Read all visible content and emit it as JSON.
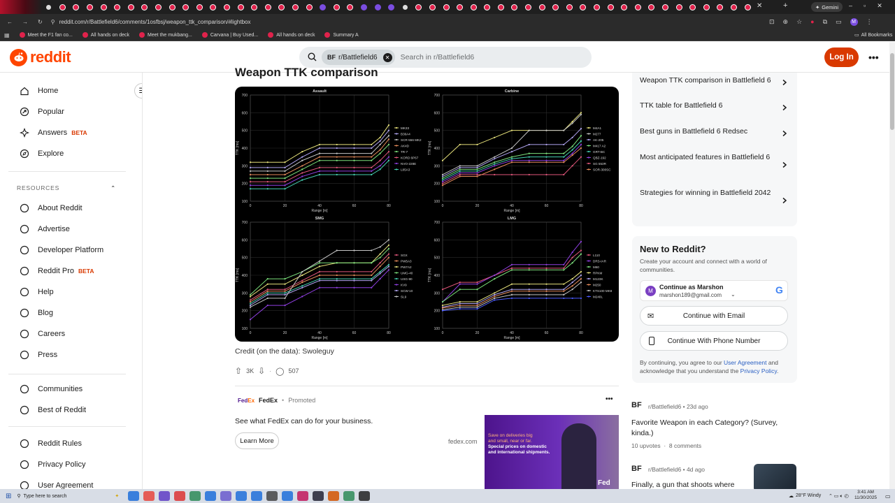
{
  "browser": {
    "url": "reddit.com/r/Battlefield6/comments/1osfbsj/weapon_ttk_comparison/#lightbox",
    "gemini_label": "Gemini",
    "bookmarks": [
      "Meet the F1 fan co...",
      "All hands on deck",
      "Meet the mukbang...",
      "Carvana | Buy Used...",
      "All hands on deck",
      "Summary A"
    ],
    "all_bookmarks": "All Bookmarks"
  },
  "header": {
    "logo_text": "reddit",
    "search_chip": "r/Battlefield6",
    "search_placeholder": "Search in r/Battlefield6",
    "login_label": "Log In"
  },
  "leftnav": {
    "main_items": [
      {
        "label": "Home",
        "icon": "home-icon"
      },
      {
        "label": "Popular",
        "icon": "popular-icon"
      },
      {
        "label": "Answers",
        "badge": "BETA",
        "icon": "answers-icon"
      },
      {
        "label": "Explore",
        "icon": "explore-icon"
      }
    ],
    "resources_header": "RESOURCES",
    "resources": [
      {
        "label": "About Reddit"
      },
      {
        "label": "Advertise"
      },
      {
        "label": "Developer Platform"
      },
      {
        "label": "Reddit Pro",
        "badge": "BETA"
      },
      {
        "label": "Help"
      },
      {
        "label": "Blog"
      },
      {
        "label": "Careers"
      },
      {
        "label": "Press"
      }
    ],
    "more": [
      {
        "label": "Communities"
      },
      {
        "label": "Best of Reddit"
      }
    ],
    "legal": [
      {
        "label": "Reddit Rules"
      },
      {
        "label": "Privacy Policy"
      },
      {
        "label": "User Agreement"
      }
    ]
  },
  "post": {
    "title": "Weapon TTK comparison",
    "credit": "Credit (on the data): Swoleguy",
    "upvotes": "3K",
    "comments": "507"
  },
  "ad": {
    "brand": "FedEx",
    "promoted": "Promoted",
    "text": "See what FedEx can do for your business.",
    "learn_more": "Learn More",
    "domain": "fedex.com",
    "banner_lines": [
      "Save on deliveries big",
      "and small, near or far.",
      "Special prices on domestic",
      "and international shipments."
    ],
    "banner_logo": "Fed"
  },
  "sidebar": {
    "related": [
      "Weapon TTK comparison in Battlefield 6",
      "TTK table for Battlefield 6",
      "Best guns in Battlefield 6 Redsec",
      "Most anticipated features in Battlefield 6",
      "Strategies for winning in Battlefield 2042"
    ],
    "new_title": "New to Reddit?",
    "new_sub": "Create your account and connect with a world of communities.",
    "google_name": "Continue as Marshon",
    "google_email": "marshon189@gmail.com",
    "email_btn": "Continue with Email",
    "phone_btn": "Continue With Phone Number",
    "terms_pre": "By continuing, you agree to our ",
    "terms_link1": "User Agreement",
    "terms_mid": " and acknowledge that you understand the ",
    "terms_link2": "Privacy Policy",
    "terms_end": ".",
    "posts": [
      {
        "sub": "r/Battlefield6",
        "age": "23d ago",
        "title": "Favorite Weapon in each Category? (Survey, kinda.)",
        "upvotes": "10 upvotes",
        "comments": "8 comments"
      },
      {
        "sub": "r/Battlefield6",
        "age": "4d ago",
        "title": "Finally, a gun that shoots where"
      }
    ]
  },
  "taskbar": {
    "search": "Type here to search",
    "weather": "28°F  Windy",
    "time": "3:41 AM",
    "date": "11/30/2025"
  },
  "chart_data": [
    {
      "type": "line",
      "title": "Assault",
      "xlabel": "Range [m]",
      "ylabel": "TTK [ms]",
      "x": [
        0,
        10,
        20,
        30,
        40,
        50,
        60,
        70,
        75,
        80
      ],
      "ylim": [
        100,
        700
      ],
      "xlim": [
        0,
        80
      ],
      "series": [
        {
          "name": "MK33",
          "color": "#e5e07a",
          "values": [
            320,
            320,
            320,
            380,
            420,
            420,
            420,
            420,
            460,
            530
          ]
        },
        {
          "name": "B36A4",
          "color": "#b0a4f0",
          "values": [
            290,
            290,
            290,
            350,
            400,
            400,
            400,
            400,
            440,
            500
          ]
        },
        {
          "name": "SCR-556 MK2",
          "color": "#c4c4c4",
          "values": [
            270,
            270,
            270,
            330,
            370,
            370,
            370,
            370,
            420,
            470
          ]
        },
        {
          "name": "AK4D",
          "color": "#e48a5a",
          "values": [
            250,
            250,
            250,
            300,
            350,
            350,
            350,
            350,
            390,
            450
          ]
        },
        {
          "name": "TR-7",
          "color": "#7be07b",
          "values": [
            230,
            230,
            230,
            280,
            330,
            330,
            330,
            330,
            370,
            420
          ]
        },
        {
          "name": "KORD 6P67",
          "color": "#e0567a",
          "values": [
            210,
            210,
            210,
            260,
            290,
            290,
            290,
            290,
            330,
            380
          ]
        },
        {
          "name": "NVO-228E",
          "color": "#8f3fe0",
          "values": [
            190,
            190,
            190,
            240,
            270,
            270,
            270,
            270,
            300,
            350
          ]
        },
        {
          "name": "L85A3",
          "color": "#45d0b0",
          "values": [
            170,
            170,
            170,
            220,
            250,
            250,
            250,
            250,
            280,
            330
          ]
        }
      ]
    },
    {
      "type": "line",
      "title": "Carbine",
      "xlabel": "Range [m]",
      "ylabel": "TTK [ms]",
      "x": [
        0,
        10,
        20,
        30,
        40,
        50,
        60,
        70,
        75,
        80
      ],
      "ylim": [
        100,
        700
      ],
      "xlim": [
        0,
        80
      ],
      "series": [
        {
          "name": "M4A1",
          "color": "#e5e07a",
          "values": [
            330,
            420,
            420,
            460,
            500,
            500,
            500,
            500,
            550,
            600
          ]
        },
        {
          "name": "M277",
          "color": "#c4c4c4",
          "values": [
            250,
            300,
            300,
            350,
            400,
            500,
            500,
            500,
            540,
            590
          ]
        },
        {
          "name": "AK-205",
          "color": "#b0a4f0",
          "values": [
            240,
            290,
            290,
            340,
            380,
            420,
            420,
            420,
            460,
            510
          ]
        },
        {
          "name": "M417 A2",
          "color": "#7be07b",
          "values": [
            230,
            280,
            280,
            320,
            350,
            370,
            370,
            370,
            410,
            470
          ]
        },
        {
          "name": "GRT-BC",
          "color": "#45d0b0",
          "values": [
            220,
            270,
            270,
            310,
            340,
            350,
            350,
            350,
            390,
            440
          ]
        },
        {
          "name": "QBZ-192",
          "color": "#8f3fe0",
          "values": [
            210,
            260,
            260,
            300,
            330,
            330,
            330,
            330,
            370,
            420
          ]
        },
        {
          "name": "SG 553R",
          "color": "#e0567a",
          "values": [
            200,
            250,
            250,
            250,
            250,
            250,
            250,
            250,
            300,
            350
          ]
        },
        {
          "name": "SOR-300SC",
          "color": "#e48a5a",
          "values": [
            190,
            240,
            240,
            280,
            320,
            320,
            320,
            320,
            360,
            400
          ]
        }
      ]
    },
    {
      "type": "line",
      "title": "SMG",
      "xlabel": "Range [m]",
      "ylabel": "TTK [ms]",
      "x": [
        0,
        10,
        20,
        30,
        40,
        50,
        60,
        70,
        75,
        80
      ],
      "ylim": [
        100,
        700
      ],
      "xlim": [
        0,
        80
      ],
      "series": [
        {
          "name": "SGX",
          "color": "#e0567a",
          "values": [
            260,
            320,
            320,
            370,
            420,
            420,
            420,
            420,
            470,
            520
          ]
        },
        {
          "name": "PW5A3",
          "color": "#e48a5a",
          "values": [
            250,
            310,
            310,
            360,
            400,
            400,
            400,
            400,
            450,
            500
          ]
        },
        {
          "name": "PW7A2",
          "color": "#e5e07a",
          "values": [
            280,
            350,
            350,
            400,
            450,
            470,
            470,
            470,
            520,
            570
          ]
        },
        {
          "name": "UMG-40",
          "color": "#7be07b",
          "values": [
            290,
            380,
            380,
            420,
            470,
            470,
            470,
            470,
            500,
            550
          ]
        },
        {
          "name": "USG-90",
          "color": "#45d0b0",
          "values": [
            240,
            300,
            300,
            340,
            380,
            380,
            380,
            380,
            420,
            460
          ]
        },
        {
          "name": "KV9",
          "color": "#8f3fe0",
          "values": [
            150,
            230,
            230,
            280,
            330,
            330,
            330,
            330,
            380,
            430
          ]
        },
        {
          "name": "SCW-10",
          "color": "#b0a4f0",
          "values": [
            230,
            290,
            290,
            330,
            370,
            370,
            370,
            370,
            410,
            450
          ]
        },
        {
          "name": "SL9",
          "color": "#c4c4c4",
          "values": [
            220,
            270,
            270,
            420,
            480,
            540,
            540,
            540,
            560,
            600
          ]
        }
      ]
    },
    {
      "type": "line",
      "title": "LMG",
      "xlabel": "Range [m]",
      "ylabel": "TTK [ms]",
      "x": [
        0,
        10,
        20,
        30,
        40,
        50,
        60,
        70,
        75,
        80
      ],
      "ylim": [
        100,
        700
      ],
      "xlim": [
        0,
        80
      ],
      "series": [
        {
          "name": "L110",
          "color": "#e0567a",
          "values": [
            320,
            360,
            360,
            400,
            440,
            440,
            440,
            440,
            500,
            540
          ]
        },
        {
          "name": "DRS-IAR",
          "color": "#8f3fe0",
          "values": [
            250,
            350,
            350,
            400,
            460,
            460,
            460,
            460,
            530,
            590
          ]
        },
        {
          "name": "M60",
          "color": "#7be07b",
          "values": [
            250,
            320,
            320,
            380,
            430,
            430,
            430,
            430,
            470,
            520
          ]
        },
        {
          "name": "RPKM",
          "color": "#e5e07a",
          "values": [
            230,
            250,
            250,
            300,
            350,
            350,
            350,
            350,
            380,
            420
          ]
        },
        {
          "name": "M123K",
          "color": "#b0a4f0",
          "values": [
            220,
            240,
            240,
            290,
            320,
            320,
            320,
            320,
            360,
            400
          ]
        },
        {
          "name": "M250",
          "color": "#e48a5a",
          "values": [
            215,
            230,
            230,
            280,
            310,
            310,
            310,
            310,
            340,
            380
          ]
        },
        {
          "name": "KTS100 MK8",
          "color": "#c4c4c4",
          "values": [
            205,
            220,
            220,
            270,
            290,
            290,
            290,
            290,
            320,
            360
          ]
        },
        {
          "name": "M240L",
          "color": "#4b5bff",
          "values": [
            200,
            210,
            210,
            260,
            270,
            270,
            270,
            270,
            270,
            270
          ]
        }
      ]
    }
  ]
}
